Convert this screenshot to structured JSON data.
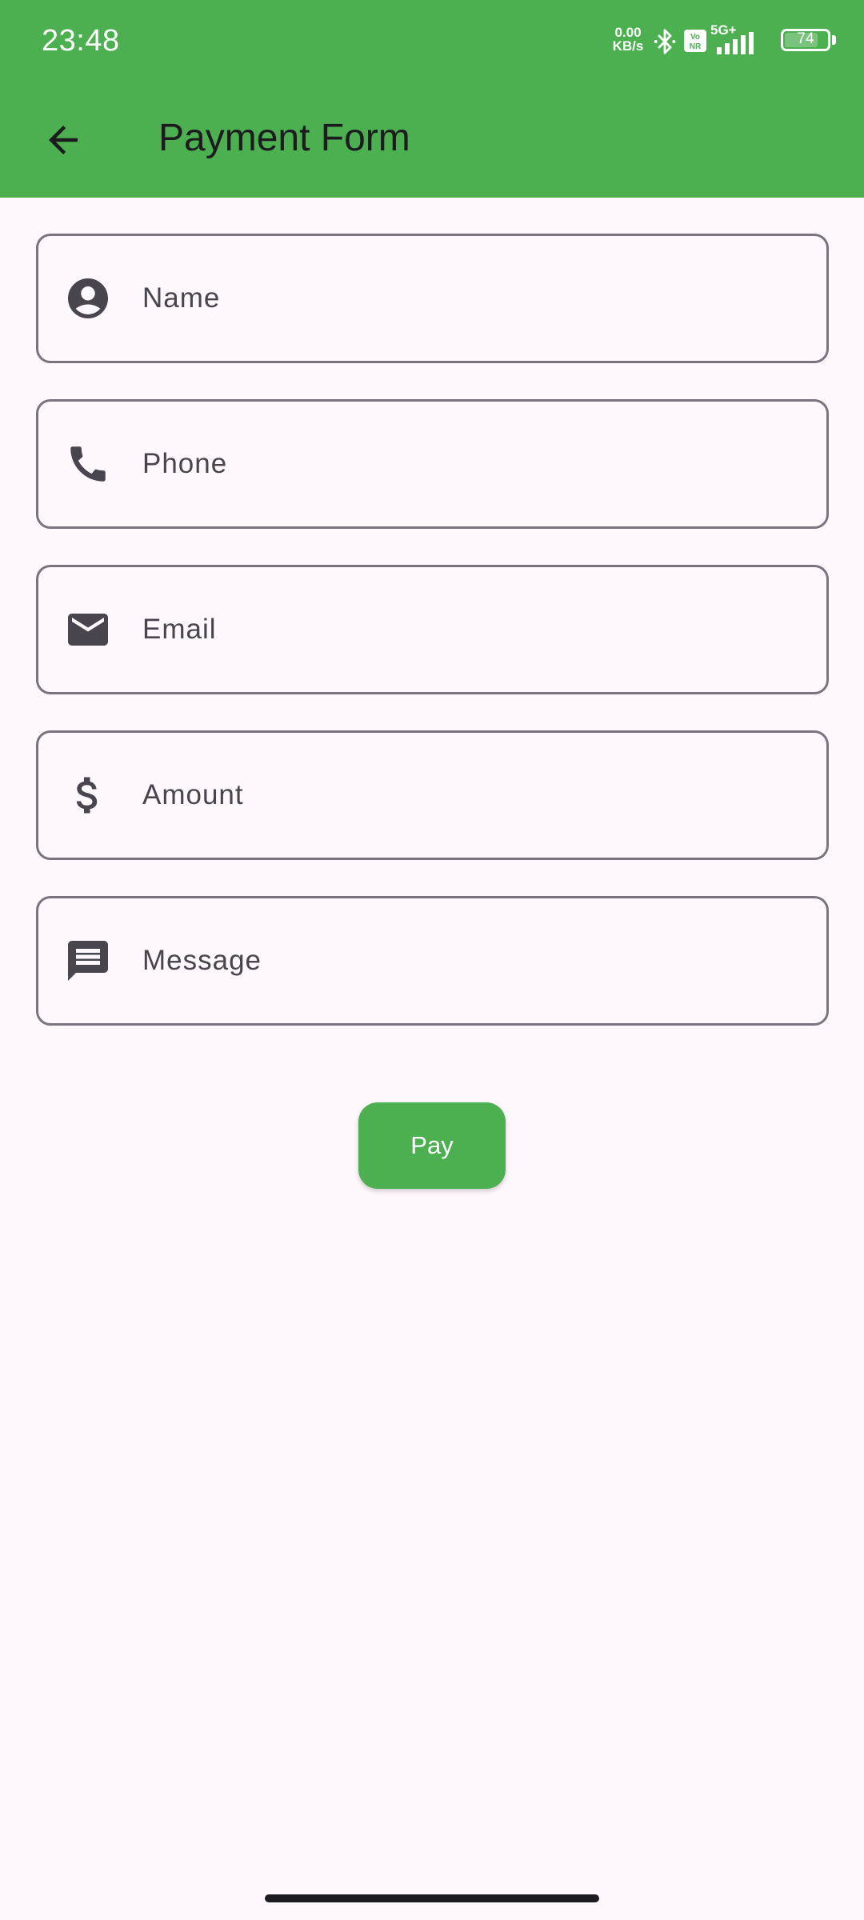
{
  "status_bar": {
    "time": "23:48",
    "net_speed_value": "0.00",
    "net_speed_unit": "KB/s",
    "network": "5G+",
    "battery": "74",
    "icons": [
      "bluetooth-icon",
      "vonr-icon",
      "signal-icon",
      "battery-icon"
    ]
  },
  "app_bar": {
    "title": "Payment Form",
    "back_icon": "arrow-back-icon"
  },
  "form": {
    "fields": [
      {
        "icon": "account-circle-icon",
        "placeholder": "Name",
        "value": ""
      },
      {
        "icon": "phone-icon",
        "placeholder": "Phone",
        "value": ""
      },
      {
        "icon": "email-icon",
        "placeholder": "Email",
        "value": ""
      },
      {
        "icon": "dollar-icon",
        "placeholder": "Amount",
        "value": ""
      },
      {
        "icon": "message-icon",
        "placeholder": "Message",
        "value": ""
      }
    ],
    "submit_label": "Pay"
  },
  "colors": {
    "primary": "#4CAF50",
    "background": "#FEF7FB",
    "outline": "#79747E",
    "icon": "#49454F",
    "on_primary": "#FFFFFF"
  }
}
